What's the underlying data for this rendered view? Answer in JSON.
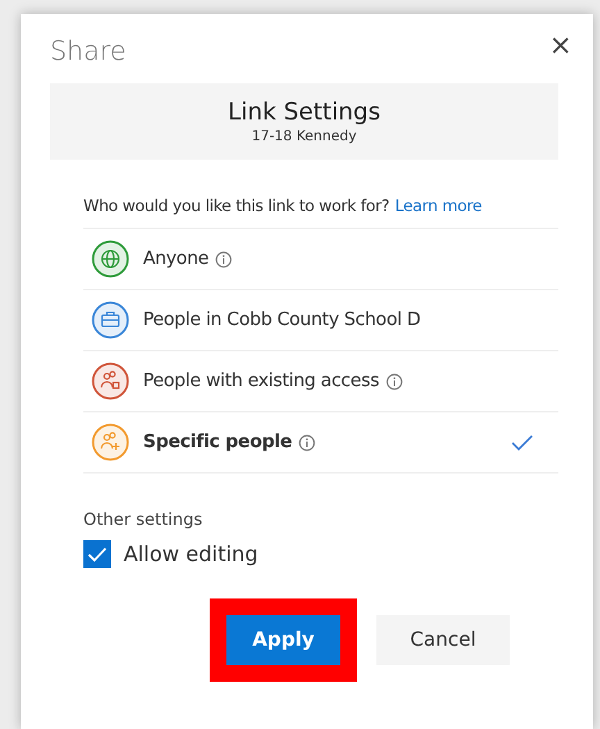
{
  "dialog": {
    "title": "Share",
    "close": "×"
  },
  "header": {
    "title": "Link Settings",
    "subtitle": "17-18 Kennedy"
  },
  "question": {
    "text": "Who would you like this link to work for?",
    "link": "Learn more"
  },
  "options": [
    {
      "kind": "globe",
      "label": "Anyone",
      "info": true,
      "selected": false,
      "color": "#2e9b3a"
    },
    {
      "kind": "briefcase",
      "label": "People in Cobb County School D",
      "info": false,
      "selected": false,
      "color": "#3a86d8"
    },
    {
      "kind": "people-lock",
      "label": "People with existing access",
      "info": true,
      "selected": false,
      "color": "#d0553a"
    },
    {
      "kind": "people-add",
      "label": "Specific people",
      "info": true,
      "selected": true,
      "color": "#f29a2e"
    }
  ],
  "other_settings": {
    "heading": "Other settings",
    "allow_editing": {
      "label": "Allow editing",
      "checked": true
    }
  },
  "buttons": [
    {
      "kind": "primary",
      "label": "Apply",
      "highlighted": true
    },
    {
      "kind": "secondary",
      "label": "Cancel",
      "highlighted": false
    }
  ]
}
